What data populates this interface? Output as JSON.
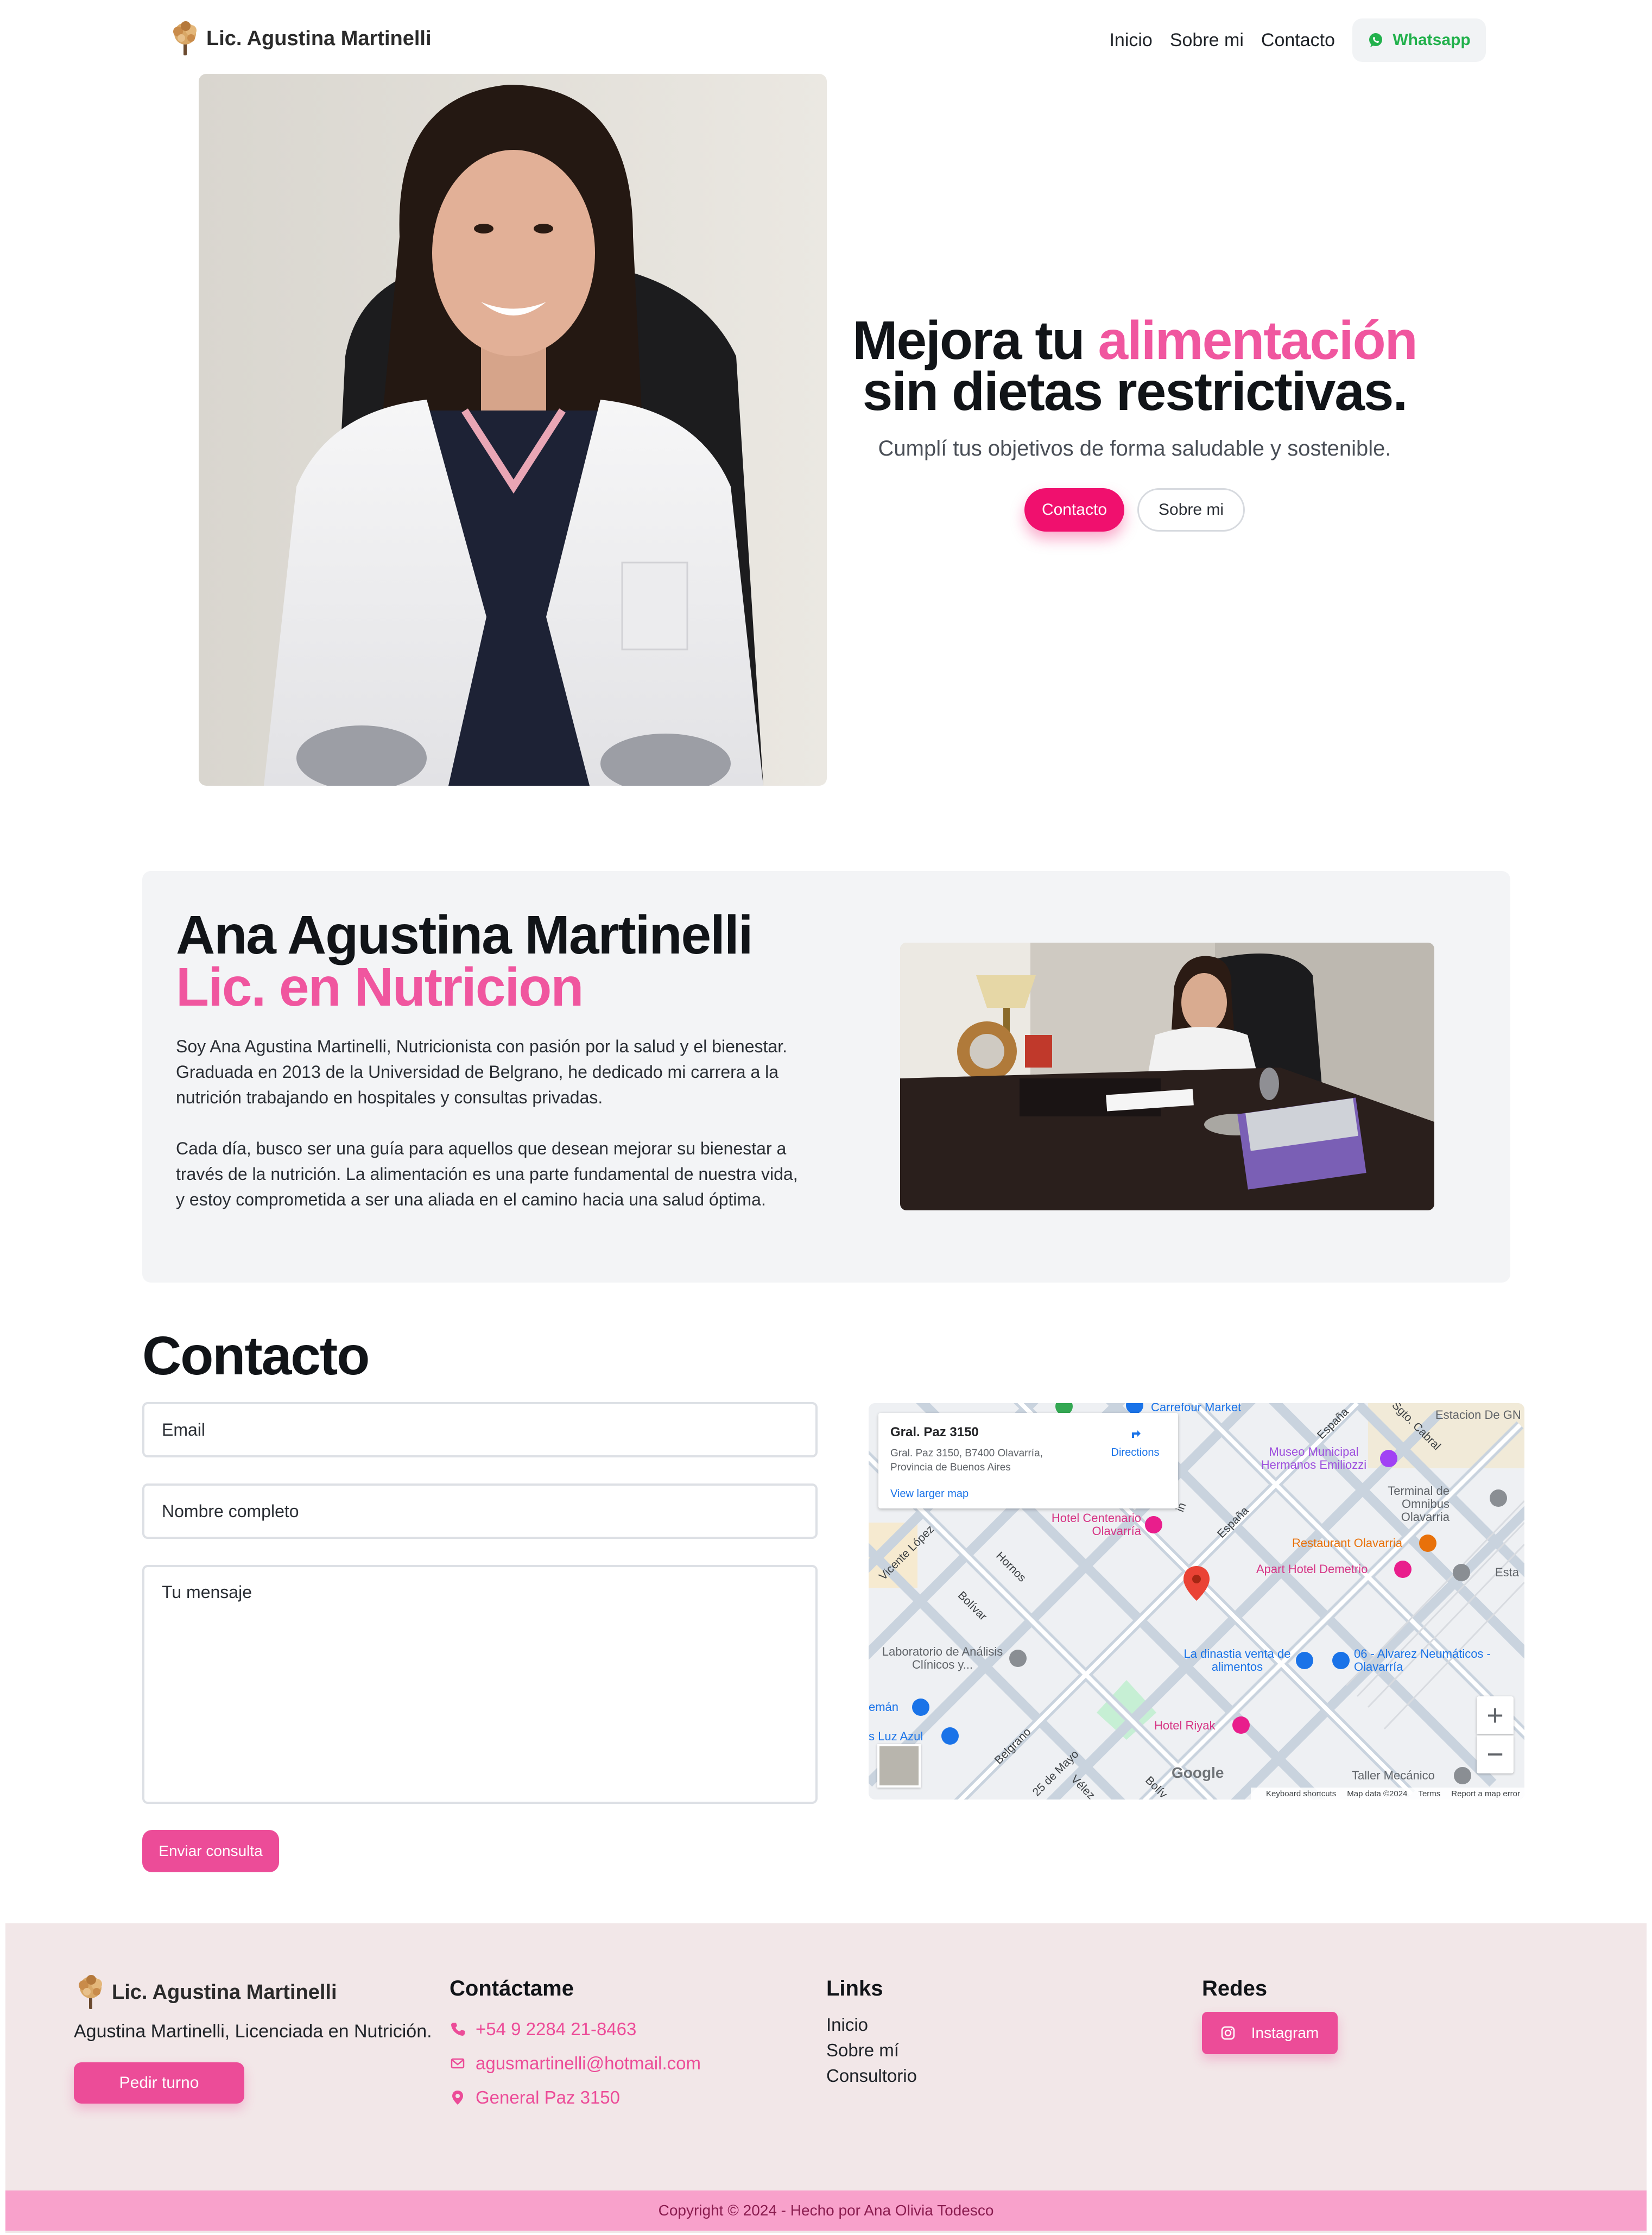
{
  "brand": {
    "name": "Lic. Agustina Martinelli"
  },
  "nav": {
    "links": [
      "Inicio",
      "Sobre mi",
      "Contacto"
    ],
    "whatsapp_label": "Whatsapp"
  },
  "hero": {
    "title_part1": "Mejora tu ",
    "title_accent": "alimentación",
    "title_part2": "sin dietas restrictivas.",
    "subtitle": "Cumplí tus objetivos de forma saludable y sostenible.",
    "primary_button": "Contacto",
    "secondary_button": "Sobre mi"
  },
  "about": {
    "name": "Ana Agustina Martinelli",
    "role": "Lic. en Nutricion",
    "paragraphs": [
      "Soy Ana Agustina Martinelli, Nutricionista con pasión por la salud y el bienestar. Graduada en 2013 de la Universidad de Belgrano, he dedicado mi carrera a la nutrición trabajando en hospitales y consultas privadas.",
      "Cada día, busco ser una guía para aquellos que desean mejorar su bienestar a través de la nutrición. La alimentación es una parte fundamental de nuestra vida, y estoy comprometida a ser una aliada en el camino hacia una salud óptima."
    ]
  },
  "contact": {
    "title": "Contacto",
    "email_placeholder": "Email",
    "name_placeholder": "Nombre completo",
    "message_placeholder": "Tu mensaje",
    "submit_label": "Enviar consulta"
  },
  "map": {
    "place_title": "Gral. Paz 3150",
    "place_address": "Gral. Paz 3150, B7400 Olavarría, Provincia de Buenos Aires",
    "directions_label": "Directions",
    "larger_map_label": "View larger map",
    "labels": {
      "carrefour": "Carrefour Market",
      "museo": "Museo Municipal Hermanos Emiliozzi",
      "estacion": "Estacion De GN",
      "terminal": "Terminal de Omnibus Olavarria",
      "restaurant": "Restaurant Olavarria",
      "hotel_centenario": "Hotel Centenario Olavarría",
      "apart_hotel": "Apart Hotel Demetrio",
      "laboratorio": "Laboratorio de Análisis Clínicos y...",
      "dinastia": "La dinastia venta de alimentos",
      "alvarez": "06 - Alvarez Neumáticos - Olavarría",
      "hotel_riyak": "Hotel Riyak",
      "taller": "Taller Mecánico",
      "leman": "emán",
      "luz_azul": "s Luz Azul",
      "esta": "Esta"
    },
    "streets": [
      "Vicente López",
      "Hornos",
      "Bolívar",
      "España",
      "25 de Mayo",
      "Vélez",
      "Sgto. Cabral",
      "España",
      "Bolív",
      "Belgrano",
      "in"
    ],
    "footer": [
      "Keyboard shortcuts",
      "Map data ©2024",
      "Terms",
      "Report a map error"
    ],
    "google": "Google",
    "zoom_in": "+",
    "zoom_out": "−"
  },
  "footer": {
    "description": "Agustina Martinelli, Licenciada en Nutrición.",
    "turno_button": "Pedir turno",
    "contact_title": "Contáctame",
    "phone": "+54 9 2284 21-8463",
    "email": "agusmartinelli@hotmail.com",
    "address": "General Paz 3150",
    "links_title": "Links",
    "links": [
      "Inicio",
      "Sobre mí",
      "Consultorio"
    ],
    "social_title": "Redes",
    "instagram_label": "Instagram",
    "copyright": "Copyright © 2024 - Hecho por Ana Olivia Todesco"
  },
  "colors": {
    "accent_pink": "#f0569f",
    "button_pink": "#ec4c98",
    "hot_pink": "#f0106e",
    "whatsapp_green": "#22b14c",
    "footer_bg": "#f2e7e8",
    "copyright_bg": "#f8a1cb"
  }
}
